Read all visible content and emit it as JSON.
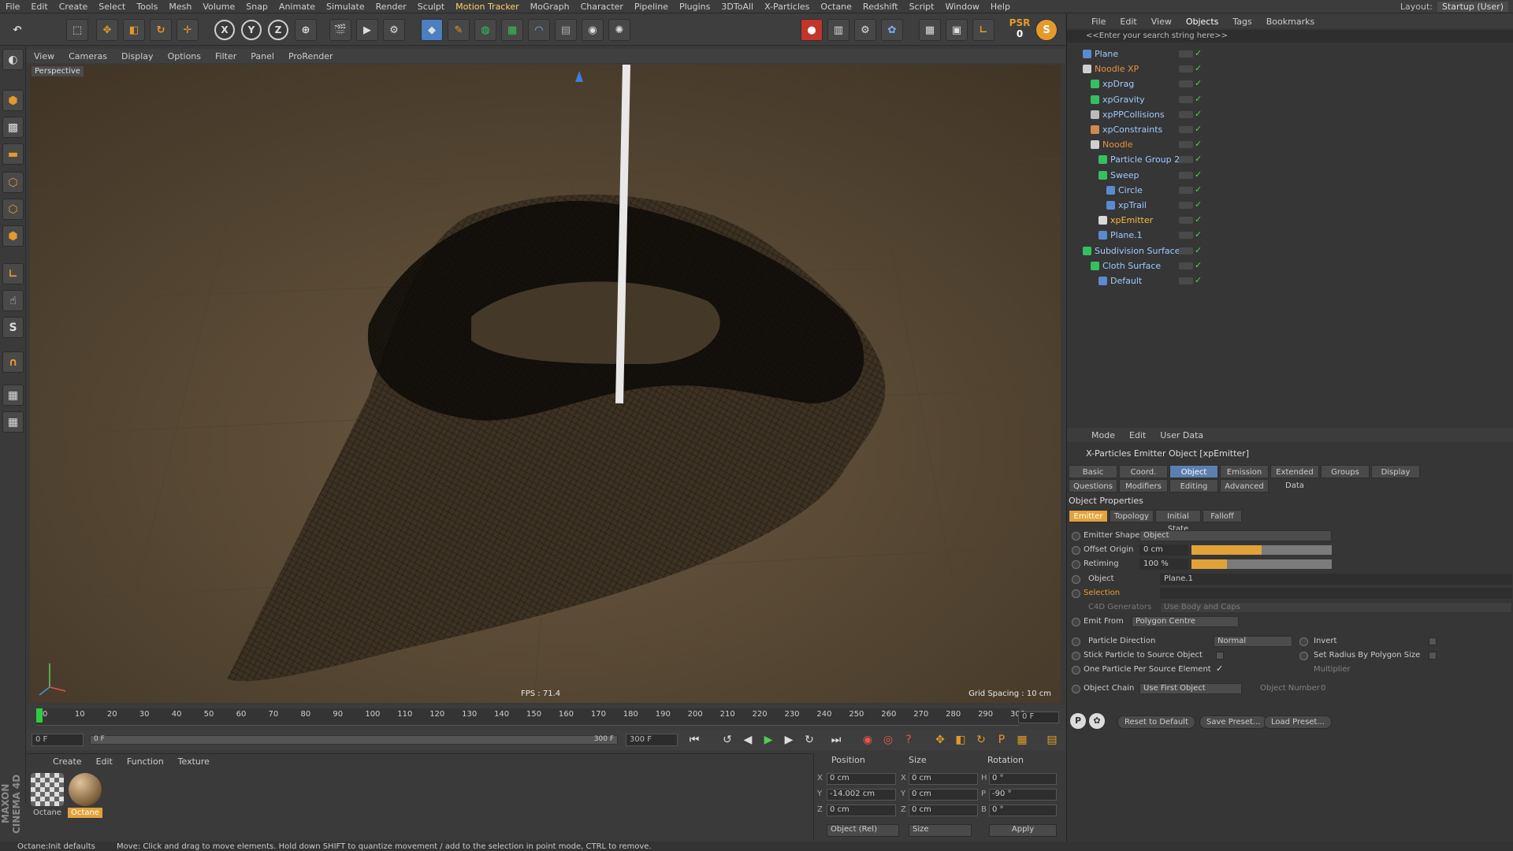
{
  "menubar": {
    "items": [
      "File",
      "Edit",
      "Create",
      "Select",
      "Tools",
      "Mesh",
      "Volume",
      "Snap",
      "Animate",
      "Simulate",
      "Render",
      "Sculpt",
      "Motion Tracker",
      "MoGraph",
      "Character",
      "Pipeline",
      "Plugins",
      "3DToAll",
      "X-Particles",
      "Octane",
      "Redshift",
      "Script",
      "Window",
      "Help"
    ],
    "layout_label": "Layout:",
    "layout_value": "Startup (User)"
  },
  "toolbar": {
    "axis_x": "X",
    "axis_y": "Y",
    "axis_z": "Z",
    "psr_label": "PSR",
    "psr_value": "0"
  },
  "viewport_menu": {
    "items": [
      "View",
      "Cameras",
      "Display",
      "Options",
      "Filter",
      "Panel",
      "ProRender"
    ]
  },
  "viewport": {
    "label": "Perspective",
    "fps": "FPS : 71.4",
    "grid_spacing": "Grid Spacing : 10 cm"
  },
  "timeline": {
    "ticks": [
      "0",
      "10",
      "20",
      "30",
      "40",
      "50",
      "60",
      "70",
      "80",
      "90",
      "100",
      "110",
      "120",
      "130",
      "140",
      "150",
      "160",
      "170",
      "180",
      "190",
      "200",
      "210",
      "220",
      "230",
      "240",
      "250",
      "260",
      "270",
      "280",
      "290",
      "300"
    ],
    "current_frame": "0 F"
  },
  "transport": {
    "start": "0 F",
    "slider_start": "0 F",
    "slider_end": "300 F",
    "end": "300 F"
  },
  "material_manager": {
    "menu": [
      "Create",
      "Edit",
      "Function",
      "Texture"
    ],
    "materials": [
      {
        "name": "Octane",
        "selected": false
      },
      {
        "name": "Octane",
        "selected": true
      }
    ]
  },
  "coordinates": {
    "headers": [
      "Position",
      "Size",
      "Rotation"
    ],
    "rows": [
      {
        "axis": "X",
        "pos": "0 cm",
        "size_axis": "X",
        "size": "0 cm",
        "rot_axis": "H",
        "rot": "0 °"
      },
      {
        "axis": "Y",
        "pos": "-14.002 cm",
        "size_axis": "Y",
        "size": "0 cm",
        "rot_axis": "P",
        "rot": "-90 °"
      },
      {
        "axis": "Z",
        "pos": "0 cm",
        "size_axis": "Z",
        "size": "0 cm",
        "rot_axis": "B",
        "rot": "0 °"
      }
    ],
    "mode": "Object (Rel)",
    "size_mode": "Size",
    "apply": "Apply"
  },
  "brand": "MAXON CINEMA 4D",
  "status": {
    "left": "Octane:Init defaults",
    "message": "Move: Click and drag to move elements. Hold down SHIFT to quantize movement / add to the selection in point mode, CTRL to remove."
  },
  "object_manager": {
    "menu": [
      "File",
      "Edit",
      "View",
      "Objects",
      "Tags",
      "Bookmarks"
    ],
    "search_placeholder": "<<Enter your search string here>>",
    "objects": [
      {
        "name": "Plane",
        "level": 0,
        "color": "#9ecbff",
        "icon": "#5a8ad0"
      },
      {
        "name": "Noodle XP",
        "level": 0,
        "color": "#e8923a",
        "icon": "#cfcfcf"
      },
      {
        "name": "xpDrag",
        "level": 1,
        "color": "#9ecbff",
        "icon": "#35c060"
      },
      {
        "name": "xpGravity",
        "level": 1,
        "color": "#9ecbff",
        "icon": "#35c060"
      },
      {
        "name": "xpPPCollisions",
        "level": 1,
        "color": "#9ecbff",
        "icon": "#bbbbbb"
      },
      {
        "name": "xpConstraints",
        "level": 1,
        "color": "#9ecbff",
        "icon": "#d08850"
      },
      {
        "name": "Noodle",
        "level": 1,
        "color": "#e8923a",
        "icon": "#cfcfcf"
      },
      {
        "name": "Particle Group 2",
        "level": 2,
        "color": "#9ecbff",
        "icon": "#35c060"
      },
      {
        "name": "Sweep",
        "level": 2,
        "color": "#9ecbff",
        "icon": "#35c060"
      },
      {
        "name": "Circle",
        "level": 3,
        "color": "#9ecbff",
        "icon": "#5a8ad0"
      },
      {
        "name": "xpTrail",
        "level": 3,
        "color": "#9ecbff",
        "icon": "#5a8ad0"
      },
      {
        "name": "xpEmitter",
        "level": 2,
        "color": "#ffb840",
        "icon": "#d8d8d8"
      },
      {
        "name": "Plane.1",
        "level": 2,
        "color": "#9ecbff",
        "icon": "#5a8ad0"
      },
      {
        "name": "Subdivision Surface",
        "level": 0,
        "color": "#9ecbff",
        "icon": "#35c060"
      },
      {
        "name": "Cloth Surface",
        "level": 1,
        "color": "#9ecbff",
        "icon": "#35c060"
      },
      {
        "name": "Default",
        "level": 2,
        "color": "#9ecbff",
        "icon": "#5a8ad0"
      }
    ]
  },
  "attribute_manager": {
    "menu": [
      "Mode",
      "Edit",
      "User Data"
    ],
    "title": "X-Particles Emitter Object [xpEmitter]",
    "tabs_row1": [
      "Basic",
      "Coord.",
      "Object",
      "Emission",
      "Extended Data",
      "Groups",
      "Display"
    ],
    "tabs_row2": [
      "Questions",
      "Modifiers",
      "Editing",
      "Advanced"
    ],
    "active_tab": "Object",
    "section": "Object Properties",
    "subtabs": [
      "Emitter",
      "Topology",
      "Initial State",
      "Falloff"
    ],
    "props": {
      "emitter_shape_label": "Emitter Shape",
      "emitter_shape_value": "Object",
      "offset_origin_label": "Offset Origin",
      "offset_origin_value": "0 cm",
      "offset_origin_fill": 0.5,
      "retiming_label": "Retiming",
      "retiming_value": "100 %",
      "retiming_fill": 0.25,
      "object_label": "Object",
      "object_value": "Plane.1",
      "selection_label": "Selection",
      "c4d_generators_label": "C4D Generators",
      "c4d_generators_value": "Use Body and Caps",
      "emit_from_label": "Emit From",
      "emit_from_value": "Polygon Centre",
      "particle_direction_label": "Particle Direction",
      "particle_direction_value": "Normal",
      "invert_label": "Invert",
      "stick_label": "Stick Particle to Source Object",
      "set_radius_label": "Set Radius By Polygon Size",
      "one_particle_label": "One Particle Per Source Element",
      "multiplier_label": "Multiplier",
      "object_chain_label": "Object Chain",
      "object_chain_value": "Use First Object",
      "object_number_label": "Object Number",
      "object_number_value": "0"
    },
    "buttons": [
      "Reset to Default",
      "Save Preset...",
      "Load Preset..."
    ]
  }
}
